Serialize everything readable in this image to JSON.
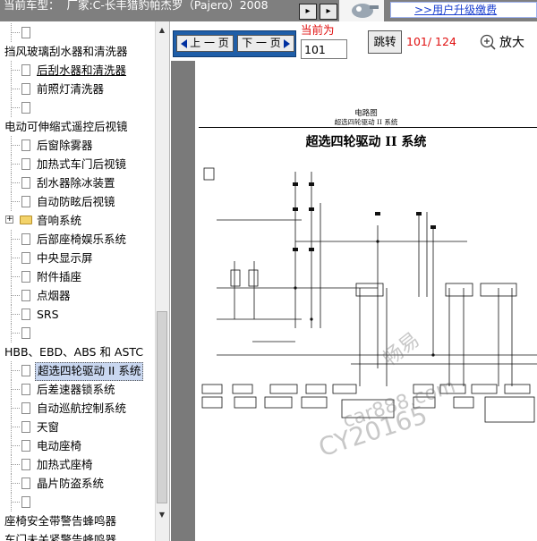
{
  "header": {
    "car_label": "当前车型：  厂家:C-长丰猎豹帕杰罗（Pajero）2008",
    "upgrade_link": ">>用户升级缴费",
    "btn1_symbol": "▸",
    "btn2_symbol": "▸"
  },
  "sidebar": {
    "rows": [
      {
        "text": "",
        "kind": "doc",
        "indent": 1
      },
      {
        "text": "挡风玻璃刮水器和清洗器",
        "kind": "section",
        "indent": 0
      },
      {
        "text": "后刮水器和清洗器",
        "kind": "doc",
        "indent": 1,
        "underline": true
      },
      {
        "text": "前照灯清洗器",
        "kind": "doc",
        "indent": 1
      },
      {
        "text": "",
        "kind": "doc",
        "indent": 1
      },
      {
        "text": "电动可伸缩式遥控后视镜",
        "kind": "section",
        "indent": 0
      },
      {
        "text": "后窗除雾器",
        "kind": "doc",
        "indent": 1
      },
      {
        "text": "加热式车门后视镜",
        "kind": "doc",
        "indent": 1
      },
      {
        "text": "刮水器除冰装置",
        "kind": "doc",
        "indent": 1
      },
      {
        "text": "自动防眩后视镜",
        "kind": "doc",
        "indent": 1
      },
      {
        "text": "音响系统",
        "kind": "folder",
        "indent": 0
      },
      {
        "text": "后部座椅娱乐系统",
        "kind": "doc",
        "indent": 1
      },
      {
        "text": "中央显示屏",
        "kind": "doc",
        "indent": 1
      },
      {
        "text": "附件插座",
        "kind": "doc",
        "indent": 1
      },
      {
        "text": "点烟器",
        "kind": "doc",
        "indent": 1
      },
      {
        "text": "SRS",
        "kind": "doc",
        "indent": 1
      },
      {
        "text": "",
        "kind": "doc",
        "indent": 1
      },
      {
        "text": "HBB、EBD、ABS 和 ASTC",
        "kind": "section",
        "indent": 0
      },
      {
        "text": "超选四轮驱动 II 系统",
        "kind": "doc",
        "indent": 1,
        "selected": true
      },
      {
        "text": "后差速器锁系统",
        "kind": "doc",
        "indent": 1
      },
      {
        "text": "自动巡航控制系统",
        "kind": "doc",
        "indent": 1
      },
      {
        "text": "天窗",
        "kind": "doc",
        "indent": 1
      },
      {
        "text": "电动座椅",
        "kind": "doc",
        "indent": 1
      },
      {
        "text": "加热式座椅",
        "kind": "doc",
        "indent": 1
      },
      {
        "text": "晶片防盗系统",
        "kind": "doc",
        "indent": 1
      },
      {
        "text": "",
        "kind": "doc",
        "indent": 1
      },
      {
        "text": "座椅安全带警告蜂鸣器",
        "kind": "section",
        "indent": 0
      },
      {
        "text": "车门未关紧警告蜂鸣器",
        "kind": "section",
        "indent": 0
      }
    ]
  },
  "toolbar": {
    "prev_label": "上 一 页",
    "next_label": "下 一 页",
    "current_label": "当前为",
    "page_value": "101",
    "jump_label": "跳转",
    "page_count": "101/ 124",
    "zoom_label": "放大"
  },
  "document": {
    "header_title": "电路图",
    "header_subtitle": "超选四轮驱动 II 系统",
    "diagram_title": "超选四轮驱动 II 系统",
    "box_number": "1"
  },
  "watermarks": [
    "畅易",
    "car888.com",
    "CY20165"
  ],
  "colors": {
    "header_bg": "#7f7f7f",
    "nav_bar_bg": "#1f5ea8",
    "accent_red": "#e01010",
    "selection_bg": "#c9d7f0",
    "link_blue": "#1a3fd0",
    "doc_bg": "#7a7a7a"
  }
}
